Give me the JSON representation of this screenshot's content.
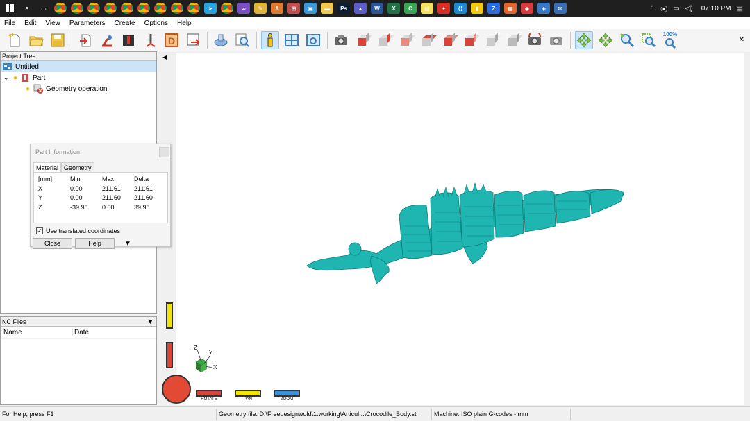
{
  "taskbar": {
    "time": "07:10 PM",
    "icons": [
      {
        "name": "search-icon",
        "glyph": "⌕",
        "color": "#1f1f1f"
      },
      {
        "name": "task-view-icon",
        "glyph": "▭",
        "color": "#1f1f1f"
      },
      {
        "name": "chrome-icon",
        "glyph": "",
        "color": "#db4437"
      },
      {
        "name": "chrome-icon",
        "glyph": "",
        "color": "#db4437"
      },
      {
        "name": "chrome-icon",
        "glyph": "",
        "color": "#db4437"
      },
      {
        "name": "chrome-icon",
        "glyph": "",
        "color": "#db4437"
      },
      {
        "name": "chrome-icon",
        "glyph": "",
        "color": "#db4437"
      },
      {
        "name": "chrome-icon",
        "glyph": "",
        "color": "#db4437"
      },
      {
        "name": "chrome-icon",
        "glyph": "",
        "color": "#db4437"
      },
      {
        "name": "chrome-icon",
        "glyph": "",
        "color": "#db4437"
      },
      {
        "name": "chrome-icon",
        "glyph": "",
        "color": "#db4437"
      },
      {
        "name": "telegram-icon",
        "glyph": "➤",
        "color": "#2aa3de"
      },
      {
        "name": "chrome-icon",
        "glyph": "",
        "color": "#db4437"
      },
      {
        "name": "visual-studio-icon",
        "glyph": "∞",
        "color": "#7b4fc4"
      },
      {
        "name": "paint-icon",
        "glyph": "✎",
        "color": "#e0b33a"
      },
      {
        "name": "acrobat-a-icon",
        "glyph": "A",
        "color": "#e07a2f"
      },
      {
        "name": "cnc-app-icon",
        "glyph": "⊞",
        "color": "#c0504d"
      },
      {
        "name": "image-viewer-icon",
        "glyph": "▣",
        "color": "#3a9ad9"
      },
      {
        "name": "folder-icon",
        "glyph": "▬",
        "color": "#f2c94c"
      },
      {
        "name": "photoshop-icon",
        "glyph": "Ps",
        "color": "#0b1e34"
      },
      {
        "name": "teams-icon",
        "glyph": "▲",
        "color": "#5b5fc7"
      },
      {
        "name": "word-icon",
        "glyph": "W",
        "color": "#2b579a"
      },
      {
        "name": "excel-icon",
        "glyph": "X",
        "color": "#217346"
      },
      {
        "name": "camtasia-icon",
        "glyph": "C",
        "color": "#3aa655"
      },
      {
        "name": "sticky-notes-icon",
        "glyph": "▤",
        "color": "#f6e05e"
      },
      {
        "name": "acrobat-icon",
        "glyph": "✦",
        "color": "#d93025"
      },
      {
        "name": "vscode-icon",
        "glyph": "⟨⟩",
        "color": "#1f8ad2"
      },
      {
        "name": "powerbi-icon",
        "glyph": "▮",
        "color": "#f2c811"
      },
      {
        "name": "z-app-icon",
        "glyph": "Z",
        "color": "#2b6de1"
      },
      {
        "name": "orange-app-icon",
        "glyph": "▦",
        "color": "#e2662e"
      },
      {
        "name": "red-app-icon",
        "glyph": "◆",
        "color": "#d83b3b"
      },
      {
        "name": "blue-app-icon",
        "glyph": "◈",
        "color": "#3478c6"
      },
      {
        "name": "mail-icon",
        "glyph": "✉",
        "color": "#3a6fb5"
      }
    ]
  },
  "menu": [
    "File",
    "Edit",
    "View",
    "Parameters",
    "Create",
    "Options",
    "Help"
  ],
  "toolbar": {
    "zoom_label": "100%"
  },
  "project_tree": {
    "header": "Project Tree",
    "root": "Untitled",
    "part": "Part",
    "operation": "Geometry operation"
  },
  "part_info": {
    "title": "Part Information",
    "tabs": [
      "Material",
      "Geometry"
    ],
    "headers": [
      "[mm]",
      "Min",
      "Max",
      "Delta"
    ],
    "rows": [
      [
        "X",
        "0.00",
        "211.61",
        "211.61"
      ],
      [
        "Y",
        "0.00",
        "211.60",
        "211.60"
      ],
      [
        "Z",
        "-39.98",
        "0.00",
        "39.98"
      ]
    ],
    "checkbox_label": "Use translated coordinates",
    "checkbox_checked": true,
    "close_label": "Close",
    "help_label": "Help"
  },
  "nc_files": {
    "header": "NC Files",
    "columns": [
      "Name",
      "Date"
    ]
  },
  "viewport": {
    "model_color": "#1fb5b0",
    "axis_labels": {
      "x": "X",
      "y": "Y",
      "z": "Z"
    },
    "controls": [
      "ROTATE",
      "PAN",
      "ZOOM"
    ]
  },
  "status": {
    "help": "For Help, press F1",
    "geometry_file": "Geometry file: D:\\Freedesignwold\\1.working\\Articul...\\Crocodile_Body.stl",
    "machine": "Machine: ISO plain G-codes - mm"
  }
}
